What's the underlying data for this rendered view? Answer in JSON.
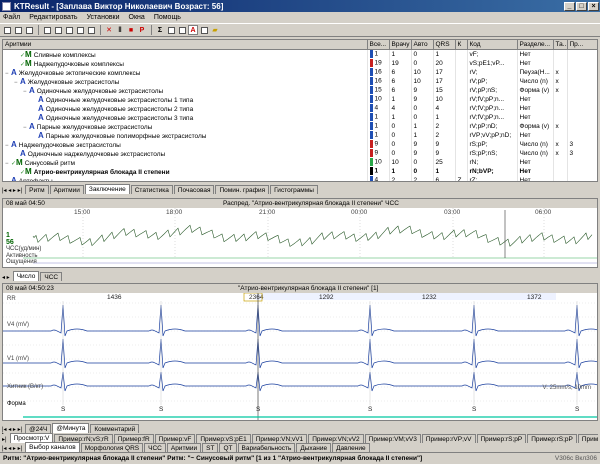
{
  "window": {
    "title": "KTResult - [Заплава Виктор Николаевич Возраст: 56]"
  },
  "menu": [
    "Файл",
    "Редактировать",
    "Установки",
    "Окна",
    "Помощь"
  ],
  "table": {
    "headers": [
      "Аритмии",
      "Все...",
      "Врачу",
      "Авто",
      "QRS",
      "К",
      "Код",
      "Разделе...",
      "Та...",
      "Пр..."
    ],
    "rows": [
      {
        "indent": 1,
        "exp": "",
        "check": true,
        "mark": "M",
        "markColor": "#006400",
        "name": "Сливные комплексы",
        "color": "#1f4fb4",
        "vals": [
          "1",
          "1",
          "0",
          "1",
          "",
          "vF;",
          "Нет",
          "",
          ""
        ],
        "bold": false
      },
      {
        "indent": 1,
        "exp": "",
        "check": true,
        "mark": "M",
        "markColor": "#006400",
        "name": "Наджелудочковые комплексы",
        "color": "#c71f1f",
        "vals": [
          "19",
          "19",
          "0",
          "20",
          "",
          "vS;pE1;vP...",
          "Нет",
          "",
          ""
        ],
        "bold": false
      },
      {
        "indent": 0,
        "exp": "−",
        "check": false,
        "mark": "A",
        "markColor": "#1f3fb4",
        "name": "Желудочковые эктопические комплексы",
        "color": "#1f4fb4",
        "vals": [
          "16",
          "6",
          "10",
          "17",
          "",
          "rV;",
          "Пеуза(Н...",
          "x",
          ""
        ],
        "bold": false
      },
      {
        "indent": 1,
        "exp": "−",
        "check": false,
        "mark": "A",
        "markColor": "#1f3fb4",
        "name": "Желудочковые экстрасистолы",
        "color": "#1f4fb4",
        "vals": [
          "16",
          "6",
          "10",
          "17",
          "",
          "rV;pP;",
          "Число (n)",
          "x",
          ""
        ],
        "bold": false
      },
      {
        "indent": 2,
        "exp": "−",
        "check": false,
        "mark": "A",
        "markColor": "#1f3fb4",
        "name": "Одиночные желудочковые экстрасистолы",
        "color": "#1f4fb4",
        "vals": [
          "15",
          "6",
          "9",
          "15",
          "",
          "rV;pP;nS;",
          "Форма (v)",
          "x",
          ""
        ],
        "bold": false
      },
      {
        "indent": 3,
        "exp": "",
        "check": false,
        "mark": "A",
        "markColor": "#1f3fb4",
        "name": "Одиночные желудочковые экстрасистолы 1 типа",
        "color": "#1f4fb4",
        "vals": [
          "10",
          "1",
          "9",
          "10",
          "",
          "rV;fV;pP;n...",
          "Нет",
          "",
          ""
        ],
        "bold": false
      },
      {
        "indent": 3,
        "exp": "",
        "check": false,
        "mark": "A",
        "markColor": "#1f3fb4",
        "name": "Одиночные желудочковые экстрасистолы 2 типа",
        "color": "#1f4fb4",
        "vals": [
          "4",
          "4",
          "0",
          "4",
          "",
          "rV;fV;pP;n...",
          "Нет",
          "",
          ""
        ],
        "bold": false
      },
      {
        "indent": 3,
        "exp": "",
        "check": false,
        "mark": "A",
        "markColor": "#1f3fb4",
        "name": "Одиночные желудочковые экстрасистолы 3 типа",
        "color": "#1f4fb4",
        "vals": [
          "1",
          "1",
          "0",
          "1",
          "",
          "rV;fV;pP;n...",
          "Нет",
          "",
          ""
        ],
        "bold": false
      },
      {
        "indent": 2,
        "exp": "−",
        "check": false,
        "mark": "A",
        "markColor": "#1f3fb4",
        "name": "Парные желудочковые экстрасистолы",
        "color": "#1f4fb4",
        "vals": [
          "1",
          "0",
          "1",
          "2",
          "",
          "rV;pP;nD;",
          "Форма (v)",
          "x",
          ""
        ],
        "bold": false
      },
      {
        "indent": 3,
        "exp": "",
        "check": false,
        "mark": "A",
        "markColor": "#1f3fb4",
        "name": "Парные желудочковые полиморфные экстрасистолы",
        "color": "#1f4fb4",
        "vals": [
          "1",
          "0",
          "1",
          "2",
          "",
          "rVP;vV;pP;nD;",
          "Нет",
          "",
          ""
        ],
        "bold": false
      },
      {
        "indent": 0,
        "exp": "−",
        "check": false,
        "mark": "A",
        "markColor": "#1f3fb4",
        "name": "Наджелудочковые экстрасистолы",
        "color": "#c71f1f",
        "vals": [
          "9",
          "0",
          "9",
          "9",
          "",
          "rS;pP;",
          "Число (n)",
          "x",
          "3"
        ],
        "bold": false
      },
      {
        "indent": 1,
        "exp": "",
        "check": false,
        "mark": "A",
        "markColor": "#1f3fb4",
        "name": "Одиночные наджелудочковые экстрасистолы",
        "color": "#c71f1f",
        "vals": [
          "9",
          "0",
          "9",
          "9",
          "",
          "rS;pP;nS;",
          "Число (n)",
          "x",
          "3"
        ],
        "bold": false
      },
      {
        "indent": 0,
        "exp": "−",
        "check": true,
        "mark": "M",
        "markColor": "#006400",
        "name": "Синусовый ритм",
        "color": "#2aa84a",
        "vals": [
          "10",
          "10",
          "0",
          "25",
          "",
          "rN;",
          "Нет",
          "",
          ""
        ],
        "bold": false
      },
      {
        "indent": 1,
        "exp": "",
        "check": true,
        "mark": "M",
        "markColor": "#006400",
        "name": "Атрио-вентрикулярная блокада II степени",
        "color": "#000000",
        "vals": [
          "1",
          "1",
          "0",
          "1",
          "",
          "rN;bVP;",
          "Нет",
          "",
          ""
        ],
        "bold": true
      },
      {
        "indent": 0,
        "exp": "",
        "check": false,
        "mark": "A",
        "markColor": "#1f3fb4",
        "name": "Артефакты",
        "color": "#1f4fb4",
        "vals": [
          "4",
          "2",
          "2",
          "6",
          "Z",
          "rZ;",
          "Нет",
          "",
          ""
        ],
        "bold": false
      }
    ]
  },
  "tabs_top": [
    "Ритм",
    "Аритмии",
    "Заключение",
    "Статистика",
    "Почасовая",
    "Помин. графия",
    "Гистограммы"
  ],
  "trend": {
    "header_left": "08 май 04:50",
    "header_center": "Распред. \"Атрио-вентрикулярная блокада II степени\" ЧСС",
    "times": [
      "15:00",
      "18:00",
      "21:00",
      "00:00",
      "03:00",
      "06:00"
    ],
    "labels": {
      "marker": "1",
      "hr_value": "56",
      "hr_label": "ЧСС(уд/мин)",
      "activity": "Активность",
      "sensation": "Ощущения"
    }
  },
  "tabs_mid": [
    "Число",
    "ЧСС"
  ],
  "ecg": {
    "header_left": "08 май 04:50:23",
    "header_center": "\"Атрио-вентрикулярная блокада II степени\" [1]",
    "rr_label": "RR",
    "rr_values": [
      "1436",
      "2364",
      "1292",
      "1232",
      "1372"
    ],
    "lead_labels": [
      "V4 (mV)",
      "V1 (mV)",
      "Хитник (В/кт)"
    ],
    "beats": [
      "S",
      "S",
      "S",
      "S",
      "S",
      "S"
    ],
    "scale": "V: 25mm/s, 10mm",
    "forma": "Форма"
  },
  "tabs_bottom": [
    "@24Ч",
    "@Минута",
    "Комментарий"
  ],
  "tabs_records": [
    "Просмотр:V",
    "Пример:rN;vS;rR",
    "Пример:fR",
    "Пример:vF",
    "Пример:vS;pE1",
    "Пример:VN;vV1",
    "Пример:VN;vV2",
    "Пример:VM;vV3",
    "Пример:rVP;vV",
    "Пример:rS;pP",
    "Пример:rS;pP",
    "Пример:rN",
    "Пример:rN;b"
  ],
  "tabs_bottom2": [
    "Выбор каналов",
    "Морфология QRS",
    "ЧСС",
    "Аритмии",
    "ST",
    "QT",
    "Вариабельность",
    "Дыхание",
    "Давление"
  ],
  "status": {
    "text": "Ритм: \"Атрио-вентрикулярная блокада II степени\"   Ритм: \"~ Синусовый ритм\"   [1 из 1 \"Атрио-вентрикулярная блокада II степени\"]",
    "version": "V306с   Вкл306"
  },
  "colors": {
    "title_from": "#0a246a",
    "title_to": "#3a6ea5",
    "ecg_line": "#1a3f9e",
    "trend_line": "#2a5a2a",
    "highlight": "#00c8a0"
  }
}
